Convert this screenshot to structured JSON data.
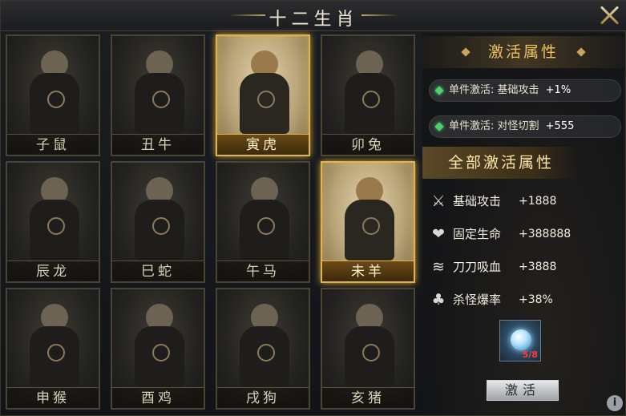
{
  "header": {
    "title": "十二生肖"
  },
  "cards": [
    {
      "name": "子鼠",
      "active": false
    },
    {
      "name": "丑牛",
      "active": false
    },
    {
      "name": "寅虎",
      "active": true
    },
    {
      "name": "卯兔",
      "active": false
    },
    {
      "name": "辰龙",
      "active": false
    },
    {
      "name": "巳蛇",
      "active": false
    },
    {
      "name": "午马",
      "active": false
    },
    {
      "name": "未羊",
      "active": true
    },
    {
      "name": "申猴",
      "active": false
    },
    {
      "name": "酉鸡",
      "active": false
    },
    {
      "name": "戌狗",
      "active": false
    },
    {
      "name": "亥猪",
      "active": false
    }
  ],
  "panel": {
    "activate_title": "激活属性",
    "single_attrs": [
      {
        "label": "单件激活: 基础攻击",
        "value": "+1%"
      },
      {
        "label": "单件激活: 对怪切割",
        "value": "+555"
      }
    ],
    "all_title": "全部激活属性",
    "all_attrs": [
      {
        "icon": "crossed-swords-icon",
        "glyph": "⚔",
        "label": "基础攻击",
        "value": "+1888"
      },
      {
        "icon": "heart-icon",
        "glyph": "❤",
        "label": "固定生命",
        "value": "+388888"
      },
      {
        "icon": "claw-icon",
        "glyph": "≋",
        "label": "刀刀吸血",
        "value": "+3888"
      },
      {
        "icon": "clover-icon",
        "glyph": "♣",
        "label": "杀怪爆率",
        "value": "+38%"
      }
    ],
    "item_count": "5/8",
    "activate_button": "激活",
    "info_button": "i"
  },
  "colors": {
    "accent_gold": "#e0b450",
    "title_gold": "#f0c060",
    "count_red": "#ff3b3b",
    "gem_green": "#4fd068"
  }
}
